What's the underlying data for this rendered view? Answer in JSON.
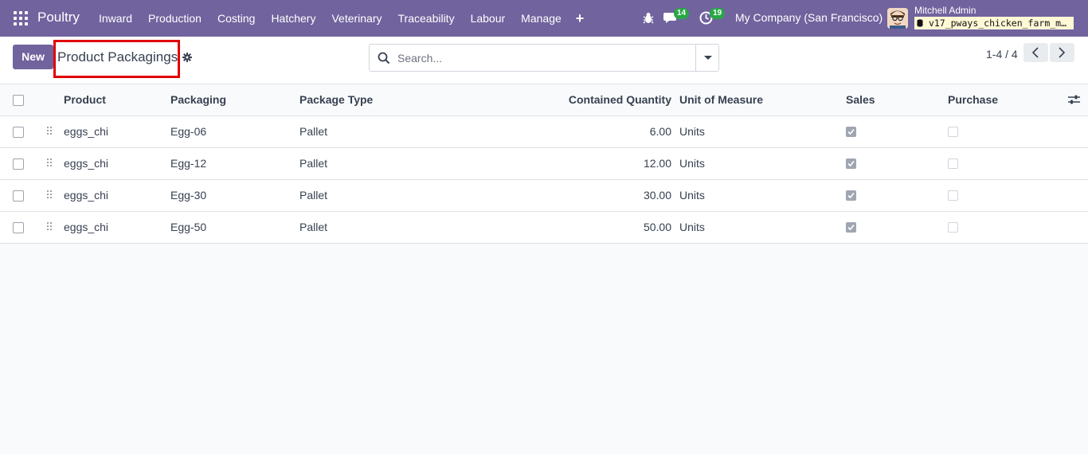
{
  "navbar": {
    "brand": "Poultry",
    "menu": [
      "Inward",
      "Production",
      "Costing",
      "Hatchery",
      "Veterinary",
      "Traceability",
      "Labour",
      "Manage"
    ],
    "plus_label": "+",
    "messages_badge": "14",
    "activities_badge": "19",
    "company": "My Company (San Francisco)",
    "user_name": "Mitchell Admin",
    "database": "v17_pways_chicken_farm_m…"
  },
  "control": {
    "new_label": "New",
    "title": "Product Packagings",
    "search_placeholder": "Search...",
    "pager": "1-4 / 4"
  },
  "table": {
    "headers": {
      "product": "Product",
      "packaging": "Packaging",
      "package_type": "Package Type",
      "contained_quantity": "Contained Quantity",
      "uom": "Unit of Measure",
      "sales": "Sales",
      "purchase": "Purchase"
    },
    "rows": [
      {
        "product": "eggs_chi",
        "packaging": "Egg-06",
        "package_type": "Pallet",
        "contained_quantity": "6.00",
        "uom": "Units",
        "sales": true,
        "purchase": false
      },
      {
        "product": "eggs_chi",
        "packaging": "Egg-12",
        "package_type": "Pallet",
        "contained_quantity": "12.00",
        "uom": "Units",
        "sales": true,
        "purchase": false
      },
      {
        "product": "eggs_chi",
        "packaging": "Egg-30",
        "package_type": "Pallet",
        "contained_quantity": "30.00",
        "uom": "Units",
        "sales": true,
        "purchase": false
      },
      {
        "product": "eggs_chi",
        "packaging": "Egg-50",
        "package_type": "Pallet",
        "contained_quantity": "50.00",
        "uom": "Units",
        "sales": true,
        "purchase": false
      }
    ]
  },
  "colors": {
    "navbar": "#71639e",
    "primary_button": "#71639e",
    "badge": "#28a745",
    "highlight_box": "#e00000"
  },
  "icons": [
    "apps-grid-icon",
    "bug-icon",
    "chat-icon",
    "clock-icon",
    "avatar",
    "database-icon",
    "gear-icon",
    "search-icon",
    "caret-down-icon",
    "chevron-left-icon",
    "chevron-right-icon",
    "drag-handle-icon",
    "column-settings-icon"
  ]
}
